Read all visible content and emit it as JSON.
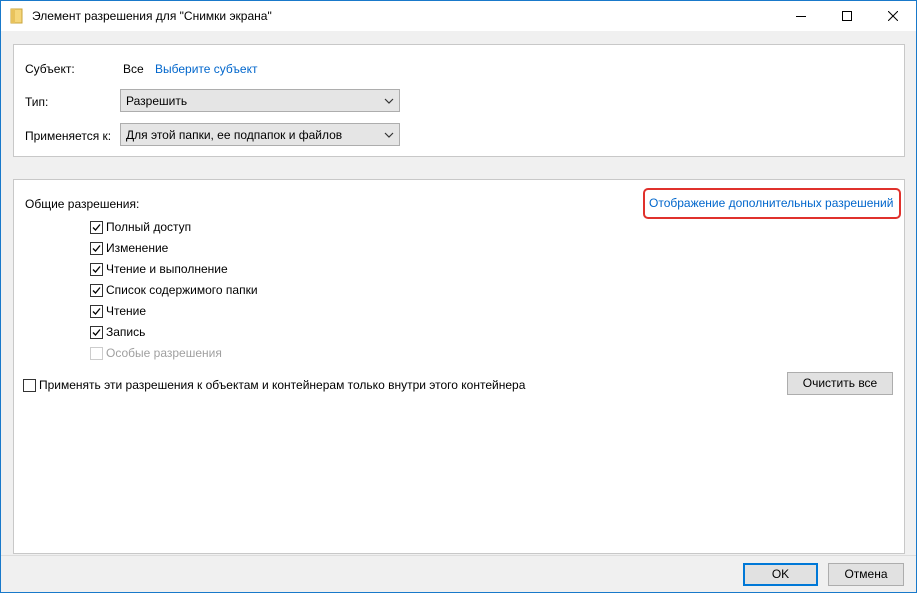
{
  "window": {
    "title": "Элемент разрешения для \"Снимки экрана\""
  },
  "subject": {
    "label": "Субъект:",
    "value": "Все",
    "select_link": "Выберите субъект"
  },
  "type": {
    "label": "Тип:",
    "selected": "Разрешить"
  },
  "applies_to": {
    "label": "Применяется к:",
    "selected": "Для этой папки, ее подпапок и файлов"
  },
  "permissions": {
    "label": "Общие разрешения:",
    "advanced_link": "Отображение дополнительных разрешений",
    "items": [
      {
        "label": "Полный доступ",
        "checked": true,
        "enabled": true
      },
      {
        "label": "Изменение",
        "checked": true,
        "enabled": true
      },
      {
        "label": "Чтение и выполнение",
        "checked": true,
        "enabled": true
      },
      {
        "label": "Список содержимого папки",
        "checked": true,
        "enabled": true
      },
      {
        "label": "Чтение",
        "checked": true,
        "enabled": true
      },
      {
        "label": "Запись",
        "checked": true,
        "enabled": true
      },
      {
        "label": "Особые разрешения",
        "checked": false,
        "enabled": false
      }
    ]
  },
  "apply_only_within": {
    "label": "Применять эти разрешения к объектам и контейнерам только внутри этого контейнера",
    "checked": false
  },
  "buttons": {
    "clear_all": "Очистить все",
    "ok": "OK",
    "cancel": "Отмена"
  },
  "colors": {
    "link": "#0066cc",
    "highlight": "#e0312c",
    "accent": "#0078d7"
  },
  "icons": {
    "title": "folder-icon",
    "minimize": "minimize-icon",
    "maximize": "maximize-icon",
    "close": "close-icon",
    "dropdown": "chevron-down-icon",
    "checkmark": "checkmark-icon"
  }
}
